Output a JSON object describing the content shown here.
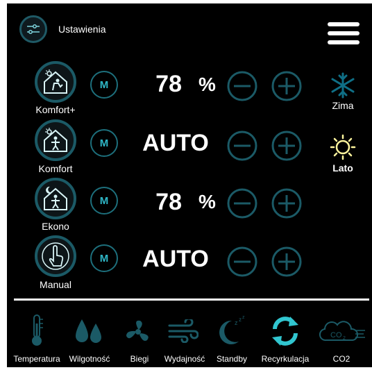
{
  "header": {
    "settings_label": "Ustawienia"
  },
  "modes": [
    {
      "label": "Komfort+",
      "value": "78",
      "unit": "%",
      "icon": "house-sun-person-icon"
    },
    {
      "label": "Komfort",
      "value": "AUTO",
      "unit": "",
      "icon": "house-sun-person-icon"
    },
    {
      "label": "Ekono",
      "value": "78",
      "unit": "%",
      "icon": "house-moon-person-icon"
    },
    {
      "label": "Manual",
      "value": "AUTO",
      "unit": "",
      "icon": "hand-pointer-icon"
    }
  ],
  "m_label": "M",
  "seasons": [
    {
      "label": "Zima",
      "icon": "snowflake-icon",
      "color": "#0f6f86"
    },
    {
      "label": "Lato",
      "icon": "sun-icon",
      "color": "#fff59d"
    }
  ],
  "bottom_bar": [
    {
      "label": "Temperatura",
      "icon": "thermometer-icon"
    },
    {
      "label": "Wilgotność",
      "icon": "water-drops-icon"
    },
    {
      "label": "Biegi",
      "icon": "fan-icon"
    },
    {
      "label": "Wydajność",
      "icon": "wind-icon"
    },
    {
      "label": "Standby",
      "icon": "moon-zzz-icon"
    },
    {
      "label": "Recyrkulacja",
      "icon": "recirculation-icon"
    },
    {
      "label": "CO2",
      "icon": "co2-cloud-icon"
    }
  ],
  "colors": {
    "accent": "#1b5a66",
    "teal": "#2fb8c8",
    "bright_cyan": "#31c6d0",
    "sun": "#fff59d"
  }
}
